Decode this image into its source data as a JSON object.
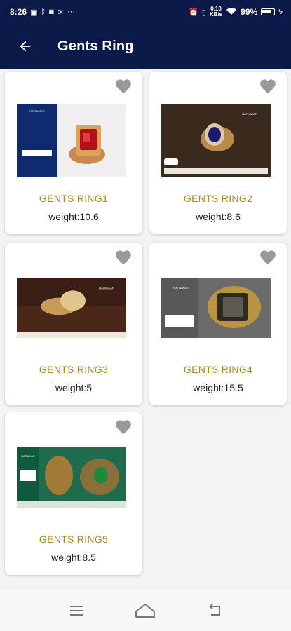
{
  "status_bar": {
    "time": "8:26",
    "left_icons": [
      "notification-icon",
      "bluetooth-icon",
      "instagram-icon",
      "tools-icon"
    ],
    "more": "···",
    "net_speed": "0.10",
    "net_unit": "KB/s",
    "battery": "99%"
  },
  "app_bar": {
    "title": "Gents Ring",
    "back_icon": "arrow-left-icon"
  },
  "brand": "RATNAKAR",
  "products": [
    {
      "name": "GENTS RING1",
      "weight": "weight:10.6",
      "favorite_icon": "heart-icon"
    },
    {
      "name": "GENTS RING2",
      "weight": "weight:8.6",
      "favorite_icon": "heart-icon"
    },
    {
      "name": "GENTS RING3",
      "weight": "weight:5",
      "favorite_icon": "heart-icon"
    },
    {
      "name": "GENTS RING4",
      "weight": "weight:15.5",
      "favorite_icon": "heart-icon"
    },
    {
      "name": "GENTS RING5",
      "weight": "weight:8.5",
      "favorite_icon": "heart-icon"
    }
  ],
  "nav_bar": {
    "items": [
      "menu-icon",
      "home-icon",
      "back-icon"
    ]
  },
  "colors": {
    "primary": "#0c1a4a",
    "product_name": "#a08a2a",
    "heart": "#999999"
  }
}
